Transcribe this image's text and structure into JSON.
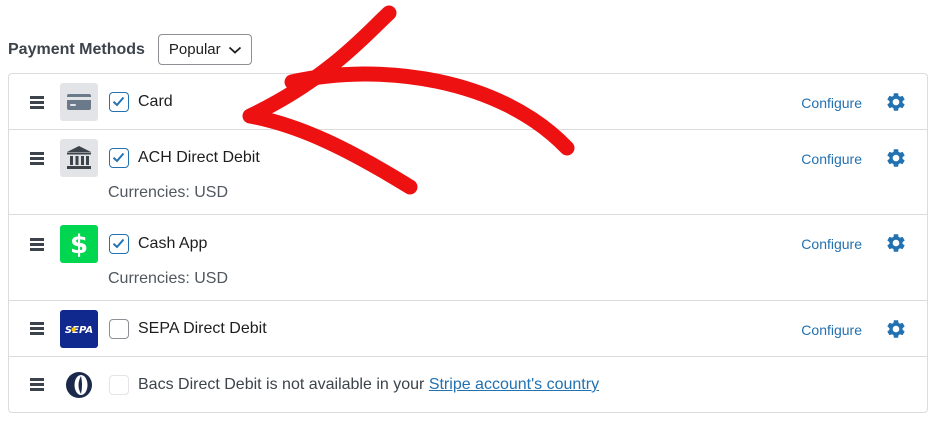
{
  "header": {
    "title": "Payment Methods",
    "filter_value": "Popular"
  },
  "methods": [
    {
      "name": "Card",
      "checked": true,
      "configure_label": "Configure",
      "icon": "card-icon"
    },
    {
      "name": "ACH Direct Debit",
      "checked": true,
      "currencies": "Currencies: USD",
      "configure_label": "Configure",
      "icon": "bank-icon"
    },
    {
      "name": "Cash App",
      "checked": true,
      "currencies": "Currencies: USD",
      "configure_label": "Configure",
      "icon": "cash-app-logo",
      "icon_color": "#00d64f"
    },
    {
      "name": "SEPA Direct Debit",
      "checked": false,
      "configure_label": "Configure",
      "icon": "sepa-logo",
      "icon_color": "#10298e",
      "icon_text": "SEPA"
    },
    {
      "checked": false,
      "disabled": true,
      "icon": "bacs-logo",
      "unavailable_text": "Bacs Direct Debit is not available in your",
      "link_text": "Stripe account's country"
    }
  ],
  "colors": {
    "accent": "#2271b1",
    "annotation_arrow": "#ee1111",
    "border": "#dcdcde"
  }
}
